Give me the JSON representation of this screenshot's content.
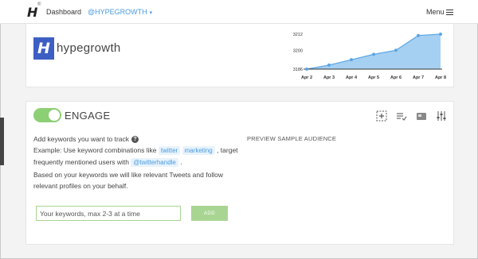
{
  "topbar": {
    "logo": "H",
    "logo_mark": "®",
    "dashboard_label": "Dashboard",
    "account_label": "@HYPEGROWTH",
    "account_caret": "▾",
    "menu_label": "Menu"
  },
  "brand": {
    "icon_letter": "H",
    "name": "hypegrowth"
  },
  "chart_data": {
    "type": "area",
    "categories": [
      "Apr 2",
      "Apr 3",
      "Apr 4",
      "Apr 5",
      "Apr 6",
      "Apr 7",
      "Apr 8"
    ],
    "values": [
      3186,
      3189,
      3193,
      3197,
      3200,
      3211,
      3212
    ],
    "y_ticks": [
      "3212",
      "3200",
      "3186"
    ],
    "ylim": [
      3186,
      3212
    ],
    "fill_color": "#a6d0f2",
    "line_color": "#5aa6e6"
  },
  "engage": {
    "title": "ENGAGE",
    "toggle_on": true,
    "toggle_color": "#8ccf74",
    "tools": [
      "target-icon",
      "list-check-icon",
      "card-icon",
      "sliders-icon"
    ],
    "line1": "Add keywords you want to track",
    "line2_pre": "Example: Use keyword combinations like",
    "kw1": "twitter",
    "kw2": "marketing",
    "line2_post": ", target",
    "line3_pre": "frequently mentioned users with",
    "handle": "@twitterhandle",
    "line3_post": ".",
    "line4": "Based on your keywords we will like relevant Tweets and follow",
    "line5": "relevant profiles on your behalf.",
    "preview_title": "PREVIEW SAMPLE AUDIENCE",
    "input_placeholder": "Your keywords, max 2-3 at a time",
    "add_label": "ADD"
  }
}
